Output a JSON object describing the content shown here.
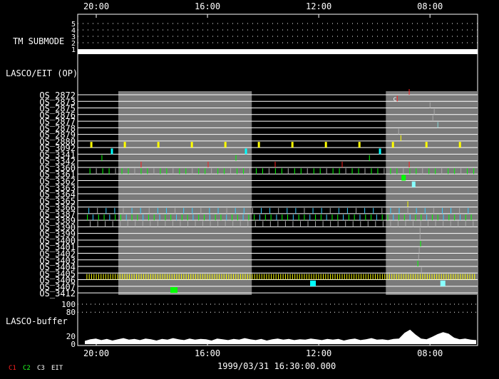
{
  "chart_data": {
    "type": "timeline",
    "axis": {
      "tick_labels": [
        "20:00",
        "16:00",
        "12:00",
        "08:00"
      ],
      "tick_hours_from_start": [
        0.667,
        4.667,
        8.667,
        12.667
      ],
      "span_hours": 14.38
    },
    "tm_submode": {
      "label": "TM SUBMODE",
      "levels": [
        "5",
        "4",
        "3",
        "2",
        "1"
      ],
      "value": 1
    },
    "section_label": "LASCO/EIT (OP)",
    "shaded_intervals_hours": [
      [
        1.46,
        6.26
      ],
      [
        11.08,
        14.38
      ]
    ],
    "rows": [
      {
        "label": "OS_2872",
        "events": [
          {
            "h": 11.92,
            "c": "#ff2020"
          }
        ]
      },
      {
        "label": "OS_2873",
        "events": [
          {
            "h": 11.49,
            "c": "#ff2020"
          }
        ],
        "note": "c"
      },
      {
        "label": "OS_2875",
        "events": [
          {
            "h": 12.67,
            "c": "#aaaaaa"
          }
        ]
      },
      {
        "label": "OS_2876",
        "events": [
          {
            "h": 12.82,
            "c": "#aaaaaa"
          }
        ]
      },
      {
        "label": "OS_2877",
        "events": [
          {
            "h": 12.77,
            "c": "#aaaaaa"
          }
        ]
      },
      {
        "label": "OS_2878",
        "events": [
          {
            "h": 12.95,
            "c": "#88dddd"
          }
        ]
      },
      {
        "label": "OS_2879",
        "events": [
          {
            "h": 11.54,
            "c": "#aaaaaa"
          }
        ]
      },
      {
        "label": "OS_2880",
        "events": [
          {
            "h": 11.62,
            "c": "#ffff00"
          }
        ]
      },
      {
        "label": "OS_3092",
        "periodic": {
          "start": 0.49,
          "period": 1.205,
          "c": "#ffff00",
          "w": 3
        }
      },
      {
        "label": "OS_3341",
        "events": [
          {
            "h": 1.23,
            "c": "#00ffff",
            "w": 3
          },
          {
            "h": 6.05,
            "c": "#00ffff",
            "w": 3
          },
          {
            "h": 10.87,
            "c": "#00ffff",
            "w": 3
          }
        ]
      },
      {
        "label": "OS_3342",
        "events": [
          {
            "h": 0.87,
            "c": "#00ff00"
          },
          {
            "h": 5.69,
            "c": "#00ff00"
          },
          {
            "h": 10.49,
            "c": "#00ff00"
          }
        ]
      },
      {
        "label": "OS_3360",
        "periodic": {
          "start": 2.28,
          "period": 2.41,
          "c": "#ff2020"
        }
      },
      {
        "label": "OS_3361",
        "periodic": {
          "start": 0.44,
          "period": 0.23,
          "c": "#00ff00",
          "alt": "#aaaaaa"
        }
      },
      {
        "label": "OS_3362",
        "events": [
          {
            "h": 11.72,
            "c": "#00ff00",
            "w": 6
          }
        ]
      },
      {
        "label": "OS_3363",
        "events": [
          {
            "h": 12.08,
            "c": "#88ffff",
            "w": 5
          }
        ]
      },
      {
        "label": "OS_3364",
        "events": []
      },
      {
        "label": "OS_3365",
        "events": []
      },
      {
        "label": "OS_3366",
        "events": [
          {
            "h": 11.87,
            "c": "#ffff00"
          }
        ]
      },
      {
        "label": "OS_3387",
        "periodic": {
          "start": 0.4,
          "period": 0.31,
          "c": "#33ccff",
          "alt": "#aaaaaa"
        }
      },
      {
        "label": "OS_3389",
        "periodic": {
          "start": 0.35,
          "period": 0.2,
          "c": "#00ff00",
          "alt": "#33ccff"
        }
      },
      {
        "label": "OS_3390",
        "periodic": {
          "start": 0.45,
          "period": 0.27,
          "c": "#aaaaaa"
        }
      },
      {
        "label": "OS_3399",
        "events": [
          {
            "h": 12.31,
            "c": "#aaaaaa"
          }
        ]
      },
      {
        "label": "OS_3400",
        "events": [
          {
            "h": 12.31,
            "c": "#aaaaaa"
          }
        ]
      },
      {
        "label": "OS_3401",
        "events": [
          {
            "h": 12.33,
            "c": "#00ff00"
          }
        ]
      },
      {
        "label": "OS_3402",
        "events": [
          {
            "h": 12.28,
            "c": "#aaaaaa"
          }
        ]
      },
      {
        "label": "OS_3403",
        "events": [
          {
            "h": 12.26,
            "c": "#aaaaaa"
          }
        ]
      },
      {
        "label": "OS_3404",
        "events": [
          {
            "h": 12.23,
            "c": "#00ff00"
          }
        ]
      },
      {
        "label": "OS_3405",
        "events": [
          {
            "h": 12.36,
            "c": "#aaaaaa"
          }
        ]
      },
      {
        "label": "OS_3406",
        "periodic": {
          "start": 0.33,
          "period": 0.085,
          "c": "#ffff00",
          "alt": "#ffff00"
        }
      },
      {
        "label": "OS_3407",
        "events": [
          {
            "h": 8.46,
            "c": "#00ffff",
            "w": 8
          },
          {
            "h": 13.13,
            "c": "#88ffff",
            "w": 7
          }
        ]
      },
      {
        "label": "OS_3412",
        "events": [
          {
            "h": 3.46,
            "c": "#00ff00",
            "w": 10
          }
        ]
      }
    ],
    "buffer": {
      "label": "LASCO-buffer",
      "ticks": [
        "100",
        "80",
        "20",
        "0"
      ],
      "values": [
        8,
        12,
        14,
        10,
        13,
        9,
        12,
        15,
        11,
        13,
        10,
        14,
        12,
        9,
        13,
        11,
        15,
        12,
        10,
        14,
        11,
        13,
        12,
        9,
        14,
        12,
        10,
        13,
        11,
        15,
        12,
        10,
        13,
        9,
        12,
        14,
        11,
        13,
        10,
        12,
        11,
        14,
        12,
        10,
        13,
        11,
        13,
        9,
        12,
        14,
        10,
        12,
        15,
        11,
        12,
        10,
        13,
        14,
        28,
        36,
        24,
        14,
        12,
        18,
        25,
        30,
        26,
        16,
        12,
        14,
        11,
        10
      ]
    },
    "footer_time": "1999/03/31 16:30:00.000",
    "legend": [
      {
        "label": "C1",
        "color": "#ff2020"
      },
      {
        "label": "C2",
        "color": "#20ff20"
      },
      {
        "label": "C3",
        "color": "#ffffff"
      },
      {
        "label": "EIT",
        "color": "#ffffff"
      }
    ]
  }
}
